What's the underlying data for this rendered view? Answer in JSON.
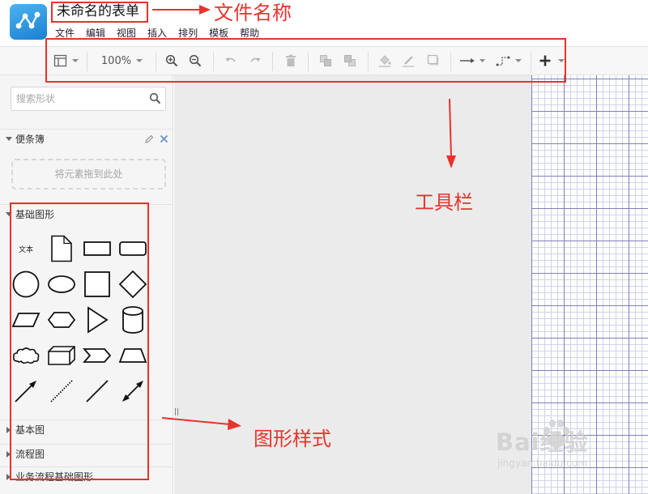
{
  "header": {
    "logo_icon": "share-nodes-icon",
    "doc_title": "未命名的表单",
    "menu": [
      "文件",
      "编辑",
      "视图",
      "插入",
      "排列",
      "模板",
      "帮助"
    ]
  },
  "toolbar": {
    "zoom_value": "100%",
    "buttons": [
      "page-layout-icon",
      "zoom-in-icon",
      "zoom-out-icon",
      "undo-icon",
      "redo-icon",
      "delete-icon",
      "bring-front-icon",
      "send-back-icon",
      "fill-color-icon",
      "line-color-icon",
      "shadow-icon",
      "connector-arrow-icon",
      "waypoint-icon",
      "plus-icon"
    ]
  },
  "sidebar": {
    "search_placeholder": "搜索形状",
    "scratchpad": {
      "title": "便条簿",
      "drop_hint": "将元素拖到此处"
    },
    "basic_shapes": {
      "title": "基础图形",
      "text_shape_label": "文本"
    },
    "collapsed_sections": [
      "基本图",
      "流程图",
      "业务流程基础图形"
    ]
  },
  "annotations": {
    "file_name": "文件名称",
    "toolbar": "工具栏",
    "shape_styles": "图形样式"
  },
  "watermark": {
    "brand": "Bai经验",
    "url": "jingyan.baidu.com"
  },
  "colors": {
    "annotation_red": "#e8322d",
    "logo_blue": "#1a7fd1",
    "grid_major": "#7e80b8",
    "grid_minor": "#cfd2ec"
  }
}
